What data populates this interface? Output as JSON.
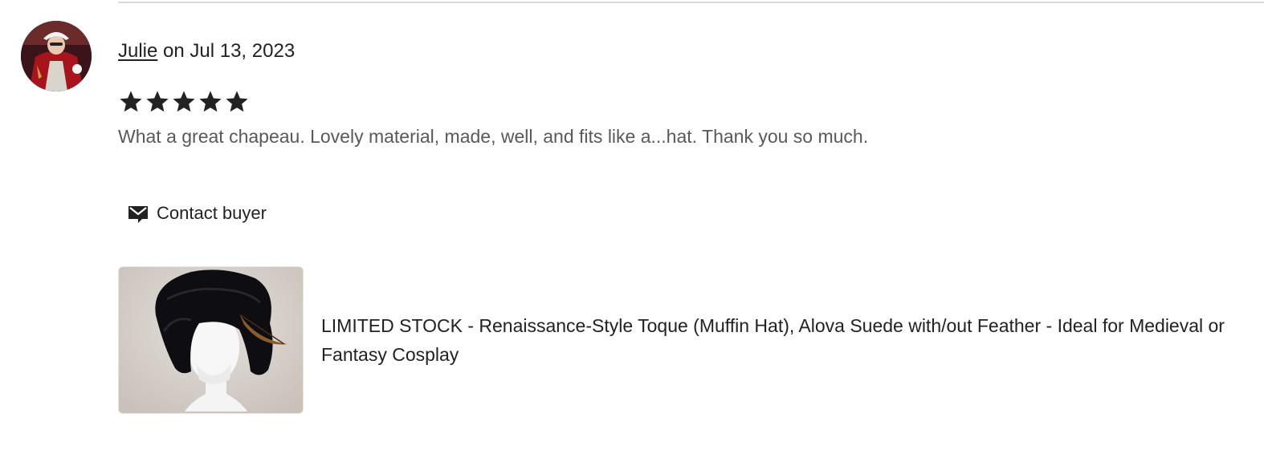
{
  "review": {
    "reviewer_name": "Julie",
    "date_text": " on Jul 13, 2023",
    "rating": 5,
    "rating_max": 5,
    "text": "What a great chapeau. Lovely material, made, well, and fits like a...hat. Thank you so much."
  },
  "contact": {
    "label": "Contact buyer",
    "icon": "mail-icon"
  },
  "listing": {
    "title": "LIMITED STOCK - Renaissance-Style Toque (Muffin Hat), Alova Suede with/out Feather - Ideal for Medieval or Fantasy Cosplay"
  },
  "colors": {
    "star": "#222222",
    "text_primary": "#222222",
    "text_secondary": "#595959"
  }
}
